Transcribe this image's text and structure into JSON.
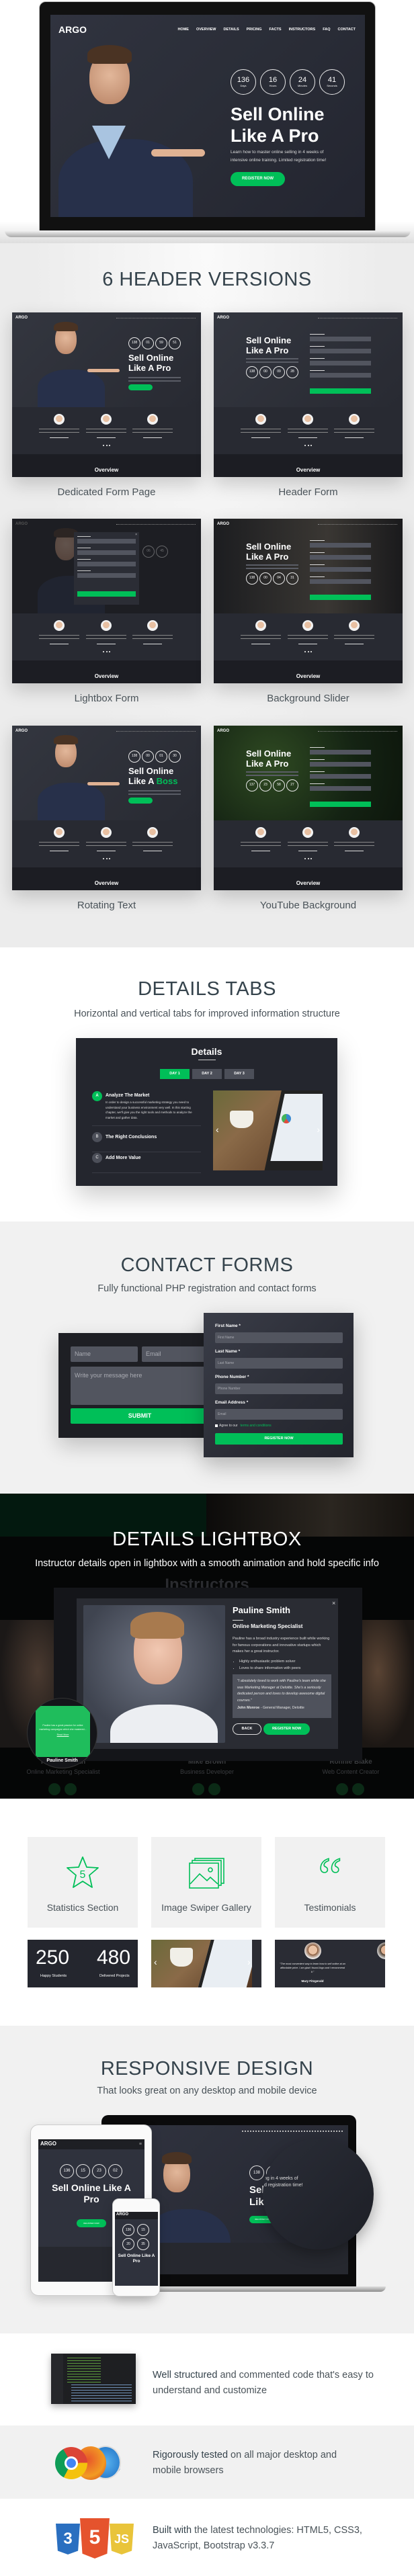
{
  "colors": {
    "accent": "#00bf58",
    "dark_panel": "#2c2e38",
    "heading": "#35434c"
  },
  "hero": {
    "logo": "ARGO",
    "nav": [
      "HOME",
      "OVERVIEW",
      "DETAILS",
      "PRICING",
      "FACTS",
      "INSTRUCTORS",
      "FAQ",
      "CONTACT"
    ],
    "countdown": [
      {
        "value": "136",
        "unit": "Days"
      },
      {
        "value": "16",
        "unit": "Hours"
      },
      {
        "value": "24",
        "unit": "Minutes"
      },
      {
        "value": "41",
        "unit": "Seconds"
      }
    ],
    "title_line1": "Sell Online",
    "title_line2": "Like A Pro",
    "text_line1": "Learn how to master online selling in 4 weeks of",
    "text_line2": "intensive online training. Limited registration time!",
    "cta": "REGISTER NOW"
  },
  "header_versions": {
    "title": "6 HEADER VERSIONS",
    "items": [
      {
        "label": "Dedicated Form Page",
        "type": "person",
        "logo": "ARGO",
        "t1": "Sell Online",
        "t2": "Like A Pro",
        "boss": "",
        "overview": "Overview",
        "countdown": [
          "138",
          "01",
          "59",
          "51"
        ]
      },
      {
        "label": "Header Form",
        "type": "form",
        "logo": "ARGO",
        "t1": "Sell Online",
        "t2": "Like A Pro",
        "boss": "",
        "overview": "Overview",
        "countdown": [
          "138",
          "00",
          "09",
          "28"
        ]
      },
      {
        "label": "Lightbox Form",
        "type": "lightbox",
        "logo": "ARGO",
        "t1": "",
        "t2": "",
        "boss": "",
        "overview": "Overview",
        "countdown": [
          "06",
          "45"
        ]
      },
      {
        "label": "Background Slider",
        "type": "slider",
        "logo": "ARGO",
        "t1": "Sell Online",
        "t2": "Like A Pro",
        "boss": "",
        "overview": "Overview",
        "countdown": [
          "138",
          "00",
          "04",
          "31"
        ]
      },
      {
        "label": "Rotating Text",
        "type": "person",
        "logo": "ARGO",
        "t1": "Sell Online",
        "t2": "Like A ",
        "boss": "Boss",
        "overview": "Overview",
        "countdown": [
          "138",
          "00",
          "01",
          "30"
        ]
      },
      {
        "label": "YouTube Background",
        "type": "youtube",
        "logo": "ARGO",
        "t1": "Sell Online",
        "t2": "Like A Pro",
        "boss": "",
        "overview": "Overview",
        "countdown": [
          "137",
          "23",
          "58",
          "27"
        ]
      }
    ]
  },
  "details_tabs": {
    "title": "DETAILS TABS",
    "subtitle": "Horizontal and vertical tabs for improved information structure",
    "panel_title": "Details",
    "tabs": [
      "DAY 1",
      "DAY 2",
      "DAY 3"
    ],
    "active_tab": 0,
    "items": [
      {
        "letter": "A",
        "title": "Analyze The Market",
        "text": "In order to design a successful marketing strategy you need to understand your business environment very well. In this starting chapter, we'll give you the right tools and methods to analyze the market and gather data."
      },
      {
        "letter": "B",
        "title": "The Right Conclusions"
      },
      {
        "letter": "C",
        "title": "Add More Value"
      }
    ]
  },
  "contact_forms": {
    "title": "CONTACT FORMS",
    "subtitle": "Fully functional PHP registration and contact forms",
    "contact": {
      "name_placeholder": "Name",
      "email_placeholder": "Email",
      "message_placeholder": "Write your message here",
      "submit": "SUBMIT"
    },
    "registration": {
      "fields": [
        {
          "label": "First Name *",
          "placeholder": "First Name"
        },
        {
          "label": "Last Name *",
          "placeholder": "Last Name"
        },
        {
          "label": "Phone Number *",
          "placeholder": "Phone Number"
        },
        {
          "label": "Email Address *",
          "placeholder": "Email"
        }
      ],
      "agree_text": "Agree to our ",
      "terms_link": "terms and conditions",
      "submit": "REGISTER NOW"
    }
  },
  "lightbox": {
    "title": "DETAILS LIGHTBOX",
    "subtitle": "Instructor details open in lightbox with a smooth animation and hold specific info",
    "bg_heading": "Instructors",
    "name": "Pauline Smith",
    "role": "Online Marketing Specialist",
    "bio": "Pauline has a broad industry experience built while working for famous corporations and innovative startups which makes her a great instructor.",
    "bullets": [
      "Highly enthusiastic problem solver",
      "Loves to share information with peers"
    ],
    "quote": "\"I absolutely loved to work with Pauline's team while she was Marketing Manager at Deloitte. She's a seriously dedicated person and loves to develop awesome digital courses.\"",
    "quote_author": "John Monroe",
    "quote_author_role": " - General Manager, Deloitte",
    "back": "BACK",
    "register": "REGISTER NOW",
    "close": "×",
    "bg_instructors": [
      {
        "name": "Pauline Smith",
        "role": "Online Marketing Specialist"
      },
      {
        "name": "Mike Brown",
        "role": "Business Developer"
      },
      {
        "name": "Ronnie Blake",
        "role": "Web Content Creator"
      }
    ],
    "hover_card": {
      "text": "Pauline has a great passion for online marketing campaigns which she mastered...",
      "link": "Read More",
      "name": "Pauline Smith"
    }
  },
  "features": {
    "cards": [
      {
        "label": "Statistics Section",
        "icon": "star-icon",
        "icon_text": "5"
      },
      {
        "label": "Image Swiper Gallery",
        "icon": "gallery-icon"
      },
      {
        "label": "Testimonials",
        "icon": "quote-icon"
      }
    ],
    "stats": [
      {
        "value": "250",
        "label": "Happy Students"
      },
      {
        "value": "480",
        "label": "Delivered Projects"
      }
    ],
    "testimonial": {
      "quote": "\"The most convenient way to learn how to sell online at an affordable price. I am glad I found Argo and I recommend it.\"",
      "author": "Mary Fitzgerald"
    }
  },
  "responsive": {
    "title": "RESPONSIVE DESIGN",
    "subtitle": "That looks great on any desktop and mobile device",
    "tablet": {
      "logo": "ARGO",
      "countdown": [
        "136",
        "15",
        "23",
        "02"
      ],
      "title": "Sell Online Like A Pro",
      "cta": "REGISTER NOW"
    },
    "phone": {
      "logo": "ARGO",
      "countdown": [
        "136",
        "15",
        "20",
        "35"
      ],
      "title": "Sell Online Like A Pro"
    },
    "laptop": {
      "countdown": [
        "138",
        "01"
      ],
      "title1": "Sell",
      "title2": "Like",
      "cta": "REGISTER NOW",
      "zoom_text1": "ng in 4 weeks of",
      "zoom_text2": "d registration time!"
    }
  },
  "benefits": [
    {
      "bold": "Well structured",
      "text": " and commented code that's easy to understand and customize",
      "icon": "code-screenshot"
    },
    {
      "bold": "Rigorously tested",
      "text": " on all major desktop and mobile browsers",
      "icon": "browser-logos"
    },
    {
      "bold": "Built with",
      "text": " the latest technologies: HTML5, CSS3, JavaScript, Bootstrap v3.3.7",
      "icon": "tech-logos"
    }
  ]
}
